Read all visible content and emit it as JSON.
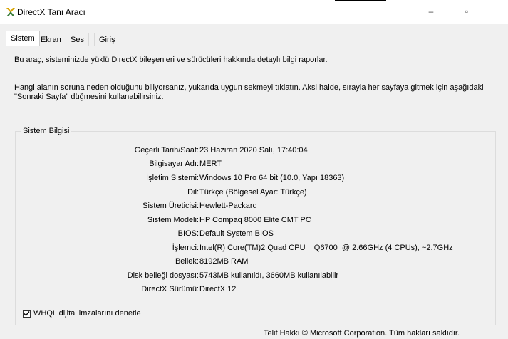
{
  "window": {
    "title": "DirectX Tanı Aracı",
    "icon": "directx-icon",
    "minimize_glyph": "–",
    "maximize_glyph": "▫"
  },
  "tabs": [
    {
      "label": "Sistem",
      "active": true
    },
    {
      "label": "Ekran",
      "active": false
    },
    {
      "label": "Ses",
      "active": false
    },
    {
      "label": "Giriş",
      "active": false
    }
  ],
  "intro": {
    "line1": "Bu araç, sisteminizde yüklü DirectX bileşenleri ve sürücüleri hakkında detaylı bilgi raporlar.",
    "line2": "Hangi alanın soruna neden olduğunu biliyorsanız, yukarıda uygun sekmeyi tıklatın. Aksi halde, sırayla her sayfaya gitmek için aşağıdaki \"Sonraki Sayfa\" düğmesini kullanabilirsiniz."
  },
  "system_info": {
    "legend": "Sistem Bilgisi",
    "rows": [
      {
        "label": "Geçerli Tarih/Saat:",
        "value": "23 Haziran 2020 Salı, 17:40:04"
      },
      {
        "label": "Bilgisayar Adı:",
        "value": "MERT"
      },
      {
        "label": "İşletim Sistemi:",
        "value": "Windows 10 Pro 64 bit (10.0, Yapı 18363)"
      },
      {
        "label": "Dil:",
        "value": "Türkçe (Bölgesel Ayar: Türkçe)"
      },
      {
        "label": "Sistem Üreticisi:",
        "value": "Hewlett-Packard"
      },
      {
        "label": "Sistem Modeli:",
        "value": "HP Compaq 8000 Elite CMT PC"
      },
      {
        "label": "BIOS:",
        "value": "Default System BIOS"
      },
      {
        "label": "İşlemci:",
        "value": "Intel(R) Core(TM)2 Quad CPU    Q6700  @ 2.66GHz (4 CPUs), ~2.7GHz"
      },
      {
        "label": "Bellek:",
        "value": "8192MB RAM"
      },
      {
        "label": "Disk belleği dosyası:",
        "value": "5743MB kullanıldı, 3660MB kullanılabilir"
      },
      {
        "label": "DirectX Sürümü:",
        "value": "DirectX 12"
      }
    ]
  },
  "whql": {
    "label": "WHQL dijital imzalarını denetle",
    "checked": true
  },
  "footer": {
    "text": "Telif Hakkı © Microsoft Corporation. Tüm hakları saklıdır."
  }
}
